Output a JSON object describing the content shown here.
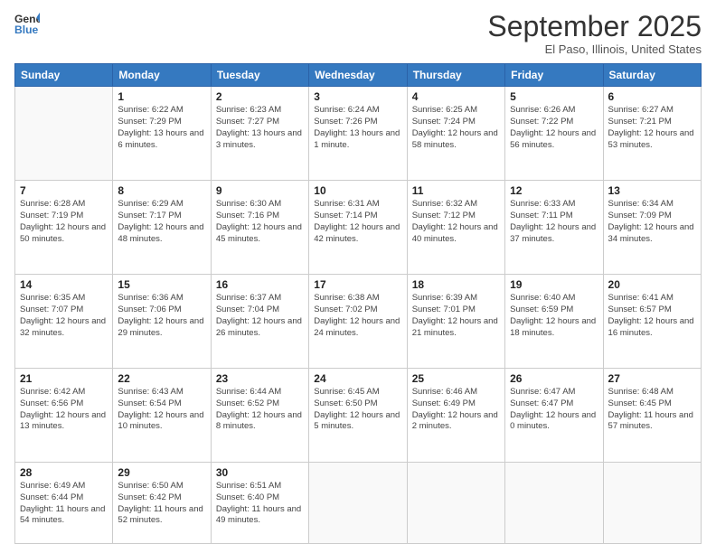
{
  "header": {
    "logo_line1": "General",
    "logo_line2": "Blue",
    "month": "September 2025",
    "location": "El Paso, Illinois, United States"
  },
  "weekdays": [
    "Sunday",
    "Monday",
    "Tuesday",
    "Wednesday",
    "Thursday",
    "Friday",
    "Saturday"
  ],
  "weeks": [
    [
      {
        "day": "",
        "info": ""
      },
      {
        "day": "1",
        "info": "Sunrise: 6:22 AM\nSunset: 7:29 PM\nDaylight: 13 hours\nand 6 minutes."
      },
      {
        "day": "2",
        "info": "Sunrise: 6:23 AM\nSunset: 7:27 PM\nDaylight: 13 hours\nand 3 minutes."
      },
      {
        "day": "3",
        "info": "Sunrise: 6:24 AM\nSunset: 7:26 PM\nDaylight: 13 hours\nand 1 minute."
      },
      {
        "day": "4",
        "info": "Sunrise: 6:25 AM\nSunset: 7:24 PM\nDaylight: 12 hours\nand 58 minutes."
      },
      {
        "day": "5",
        "info": "Sunrise: 6:26 AM\nSunset: 7:22 PM\nDaylight: 12 hours\nand 56 minutes."
      },
      {
        "day": "6",
        "info": "Sunrise: 6:27 AM\nSunset: 7:21 PM\nDaylight: 12 hours\nand 53 minutes."
      }
    ],
    [
      {
        "day": "7",
        "info": "Sunrise: 6:28 AM\nSunset: 7:19 PM\nDaylight: 12 hours\nand 50 minutes."
      },
      {
        "day": "8",
        "info": "Sunrise: 6:29 AM\nSunset: 7:17 PM\nDaylight: 12 hours\nand 48 minutes."
      },
      {
        "day": "9",
        "info": "Sunrise: 6:30 AM\nSunset: 7:16 PM\nDaylight: 12 hours\nand 45 minutes."
      },
      {
        "day": "10",
        "info": "Sunrise: 6:31 AM\nSunset: 7:14 PM\nDaylight: 12 hours\nand 42 minutes."
      },
      {
        "day": "11",
        "info": "Sunrise: 6:32 AM\nSunset: 7:12 PM\nDaylight: 12 hours\nand 40 minutes."
      },
      {
        "day": "12",
        "info": "Sunrise: 6:33 AM\nSunset: 7:11 PM\nDaylight: 12 hours\nand 37 minutes."
      },
      {
        "day": "13",
        "info": "Sunrise: 6:34 AM\nSunset: 7:09 PM\nDaylight: 12 hours\nand 34 minutes."
      }
    ],
    [
      {
        "day": "14",
        "info": "Sunrise: 6:35 AM\nSunset: 7:07 PM\nDaylight: 12 hours\nand 32 minutes."
      },
      {
        "day": "15",
        "info": "Sunrise: 6:36 AM\nSunset: 7:06 PM\nDaylight: 12 hours\nand 29 minutes."
      },
      {
        "day": "16",
        "info": "Sunrise: 6:37 AM\nSunset: 7:04 PM\nDaylight: 12 hours\nand 26 minutes."
      },
      {
        "day": "17",
        "info": "Sunrise: 6:38 AM\nSunset: 7:02 PM\nDaylight: 12 hours\nand 24 minutes."
      },
      {
        "day": "18",
        "info": "Sunrise: 6:39 AM\nSunset: 7:01 PM\nDaylight: 12 hours\nand 21 minutes."
      },
      {
        "day": "19",
        "info": "Sunrise: 6:40 AM\nSunset: 6:59 PM\nDaylight: 12 hours\nand 18 minutes."
      },
      {
        "day": "20",
        "info": "Sunrise: 6:41 AM\nSunset: 6:57 PM\nDaylight: 12 hours\nand 16 minutes."
      }
    ],
    [
      {
        "day": "21",
        "info": "Sunrise: 6:42 AM\nSunset: 6:56 PM\nDaylight: 12 hours\nand 13 minutes."
      },
      {
        "day": "22",
        "info": "Sunrise: 6:43 AM\nSunset: 6:54 PM\nDaylight: 12 hours\nand 10 minutes."
      },
      {
        "day": "23",
        "info": "Sunrise: 6:44 AM\nSunset: 6:52 PM\nDaylight: 12 hours\nand 8 minutes."
      },
      {
        "day": "24",
        "info": "Sunrise: 6:45 AM\nSunset: 6:50 PM\nDaylight: 12 hours\nand 5 minutes."
      },
      {
        "day": "25",
        "info": "Sunrise: 6:46 AM\nSunset: 6:49 PM\nDaylight: 12 hours\nand 2 minutes."
      },
      {
        "day": "26",
        "info": "Sunrise: 6:47 AM\nSunset: 6:47 PM\nDaylight: 12 hours\nand 0 minutes."
      },
      {
        "day": "27",
        "info": "Sunrise: 6:48 AM\nSunset: 6:45 PM\nDaylight: 11 hours\nand 57 minutes."
      }
    ],
    [
      {
        "day": "28",
        "info": "Sunrise: 6:49 AM\nSunset: 6:44 PM\nDaylight: 11 hours\nand 54 minutes."
      },
      {
        "day": "29",
        "info": "Sunrise: 6:50 AM\nSunset: 6:42 PM\nDaylight: 11 hours\nand 52 minutes."
      },
      {
        "day": "30",
        "info": "Sunrise: 6:51 AM\nSunset: 6:40 PM\nDaylight: 11 hours\nand 49 minutes."
      },
      {
        "day": "",
        "info": ""
      },
      {
        "day": "",
        "info": ""
      },
      {
        "day": "",
        "info": ""
      },
      {
        "day": "",
        "info": ""
      }
    ]
  ]
}
